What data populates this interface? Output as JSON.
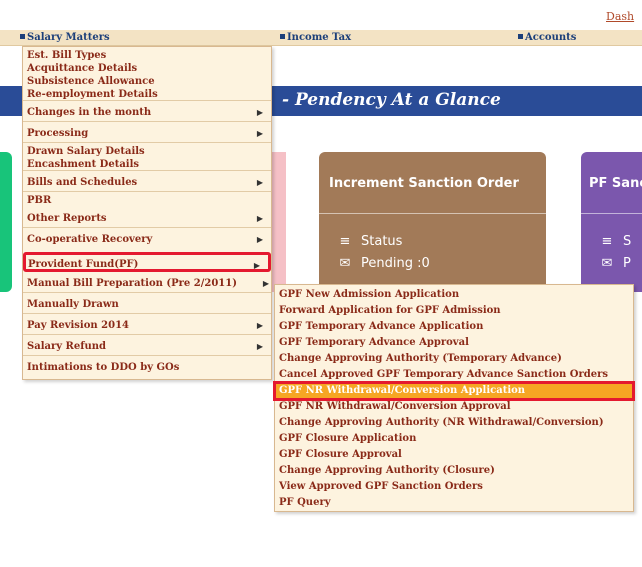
{
  "header": {
    "dash_link": "Dash"
  },
  "menubar": {
    "items": [
      {
        "label": "Salary Matters"
      },
      {
        "label": "Income Tax"
      },
      {
        "label": "Accounts"
      }
    ]
  },
  "banner": {
    "title": "- Pendency At a Glance"
  },
  "cards": [
    {
      "title": "Increment Sanction Order",
      "status_label": "Status",
      "pending_label": "Pending :0"
    },
    {
      "title": "PF Sanc",
      "status_label": "S",
      "pending_label": "P"
    }
  ],
  "salary_menu": {
    "items": [
      {
        "label": "Est. Bill Types"
      },
      {
        "label": "Acquittance Details"
      },
      {
        "label": "Subsistence Allowance"
      },
      {
        "label": "Re-employment Details"
      },
      {
        "label": "Changes in the month"
      },
      {
        "label": "Processing"
      },
      {
        "label": "Drawn Salary Details"
      },
      {
        "label": "Encashment Details"
      },
      {
        "label": "Bills and Schedules"
      },
      {
        "label": "PBR"
      },
      {
        "label": "Other Reports"
      },
      {
        "label": "Co-operative Recovery"
      },
      {
        "label": "Provident Fund(PF)"
      },
      {
        "label": "Manual Bill Preparation (Pre 2/2011)"
      },
      {
        "label": "Manually Drawn"
      },
      {
        "label": "Pay Revision 2014"
      },
      {
        "label": "Salary Refund"
      },
      {
        "label": "Intimations to DDO by GOs"
      }
    ]
  },
  "pf_submenu": {
    "items": [
      {
        "label": "GPF New Admission Application"
      },
      {
        "label": "Forward Application for GPF Admission"
      },
      {
        "label": "GPF Temporary Advance Application"
      },
      {
        "label": "GPF Temporary Advance Approval"
      },
      {
        "label": "Change Approving Authority (Temporary Advance)"
      },
      {
        "label": "Cancel Approved GPF Temporary Advance Sanction Orders"
      },
      {
        "label": "GPF NR Withdrawal/Conversion Application"
      },
      {
        "label": "GPF NR Withdrawal/Conversion Approval"
      },
      {
        "label": "Change Approving Authority (NR Withdrawal/Conversion)"
      },
      {
        "label": "GPF Closure Application"
      },
      {
        "label": "GPF Closure Approval"
      },
      {
        "label": "Change Approving Authority (Closure)"
      },
      {
        "label": "View Approved GPF Sanction Orders"
      },
      {
        "label": "PF Query"
      }
    ]
  }
}
